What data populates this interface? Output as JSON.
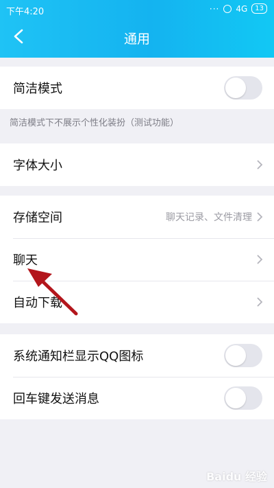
{
  "status_bar": {
    "time": "下午4:20",
    "dots": "···",
    "signal": "4G",
    "battery": "13"
  },
  "header": {
    "title": "通用"
  },
  "groups": {
    "simple_mode": {
      "label": "简洁模式",
      "toggle_on": false,
      "hint": "简洁模式下不展示个性化装扮（测试功能）"
    },
    "font": {
      "label": "字体大小"
    },
    "storage": {
      "label": "存储空间",
      "value": "聊天记录、文件清理"
    },
    "chat": {
      "label": "聊天"
    },
    "auto_download": {
      "label": "自动下载"
    },
    "notification_qq_icon": {
      "label": "系统通知栏显示QQ图标",
      "toggle_on": false
    },
    "enter_send": {
      "label": "回车键发送消息",
      "toggle_on": false
    }
  },
  "colors": {
    "header_gradient_start": "#1fc3f5",
    "header_gradient_end": "#12c8f4",
    "toggle_off": "#e4e5ec",
    "arrow_annotation": "#b3161c"
  },
  "watermark": "Baidu 经验"
}
